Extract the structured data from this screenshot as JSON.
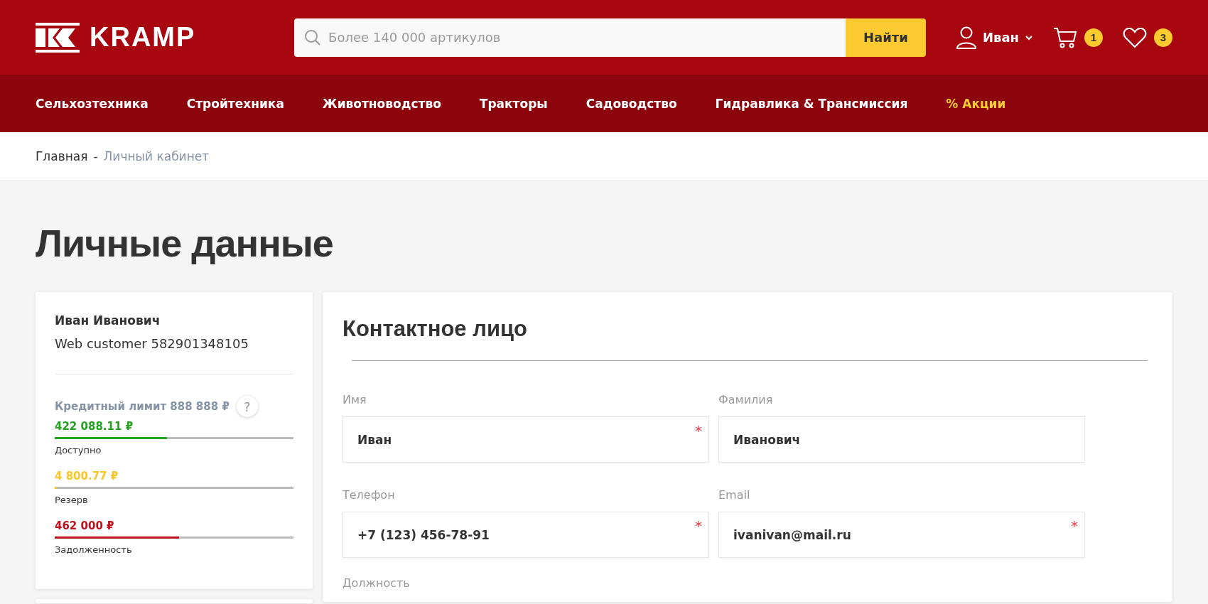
{
  "header": {
    "logo_text": "KRAMP",
    "search": {
      "placeholder": "Более 140 000 артикулов",
      "button": "Найти"
    },
    "user": {
      "name": "Иван"
    },
    "cart": {
      "count": "1"
    },
    "wishlist": {
      "count": "3"
    }
  },
  "nav": [
    {
      "label": "Сельхозтехника",
      "kind": "normal"
    },
    {
      "label": "Стройтехника",
      "kind": "normal"
    },
    {
      "label": "Животноводство",
      "kind": "normal"
    },
    {
      "label": "Тракторы",
      "kind": "normal"
    },
    {
      "label": "Садоводство",
      "kind": "normal"
    },
    {
      "label": "Гидравлика & Трансмиссия",
      "kind": "normal"
    },
    {
      "label": "% Акции",
      "kind": "promo"
    }
  ],
  "breadcrumb": [
    {
      "label": "Главная",
      "kind": "link",
      "current": false
    },
    {
      "label": "-",
      "kind": "separator"
    },
    {
      "label": "Личный кабинет",
      "kind": "link",
      "current": true
    }
  ],
  "page_title": "Личные данные",
  "account": {
    "name": "Иван Иванович",
    "customer": "Web customer 582901348105",
    "credit_limit": "Кредитный лимит 888 888 ₽",
    "help": "?",
    "balances": [
      {
        "amount": "422 088.11 ₽",
        "label": "Доступно",
        "level": 0.47,
        "color": "#22a21e"
      },
      {
        "amount": "4 800.77 ₽",
        "label": "Резерв",
        "level": 0.01,
        "color": "#fcc527"
      },
      {
        "amount": "462 000 ₽",
        "label": "Задолженность",
        "level": 0.52,
        "color": "#c0101c"
      }
    ]
  },
  "contact": {
    "title": "Контактное лицо",
    "fields": [
      {
        "label": "Имя",
        "value": "Иван",
        "required_mark": "*"
      },
      {
        "label": "Фамилия",
        "value": "Иванович"
      },
      {
        "label": "Телефон",
        "value": "+7 (123) 456-78-91",
        "required_mark": "*"
      },
      {
        "label": "Email",
        "value": "ivanivan@mail.ru",
        "required_mark": "*"
      }
    ],
    "next_label": "Должность"
  }
}
